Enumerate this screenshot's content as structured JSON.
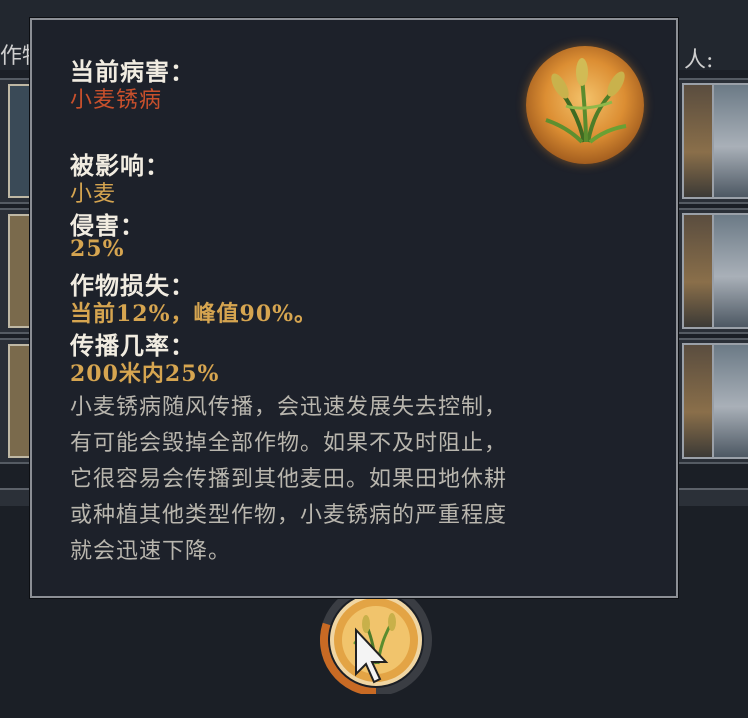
{
  "background": {
    "left_label": "作物",
    "right_label": "人:"
  },
  "tooltip": {
    "current_disease_heading": "当前病害：",
    "current_disease_value": "小麦锈病",
    "affected_heading": "被影响：",
    "affected_value": "小麦",
    "infestation_heading": "侵害：",
    "infestation_value": "25%",
    "crop_loss_heading": "作物损失：",
    "crop_loss_value": "当前12%，峰值90%。",
    "spread_chance_heading": "传播几率：",
    "spread_chance_value": "200米内25%",
    "description_lines": [
      "小麦锈病随风传播，会迅速发展失去控制，",
      "有可能会毁掉全部作物。如果不及时阻止，",
      "它很容易会传播到其他麦田。如果田地休耕",
      "或种植其他类型作物，小麦锈病的严重程度",
      "就会迅速下降。"
    ],
    "icon": "wheat-icon"
  },
  "bottom": {
    "icon": "wheat-icon",
    "cursor": "cursor-arrow-icon",
    "progress": 0.3
  },
  "colors": {
    "heading": "#f1ece1",
    "disease": "#c8502c",
    "value": "#d6a550",
    "description": "#b9b6ae",
    "badge": "#dc8e33"
  }
}
